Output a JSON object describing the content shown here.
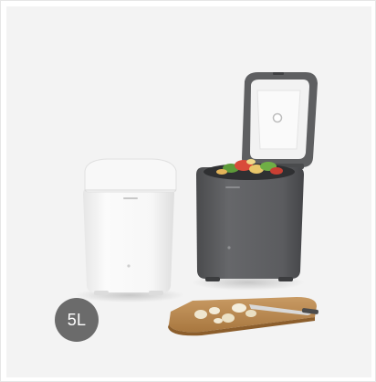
{
  "product": {
    "variants": [
      {
        "color_name": "white",
        "color": "#f4f4f4"
      },
      {
        "color_name": "dark-gray",
        "color": "#5e5f61"
      }
    ],
    "lid_logo_color": "#ffffff",
    "accent_food_colors": [
      "#d94b3a",
      "#5e9b3a",
      "#e8c66a"
    ]
  },
  "badge": {
    "label": "5L",
    "color": "#6b6b6b"
  }
}
